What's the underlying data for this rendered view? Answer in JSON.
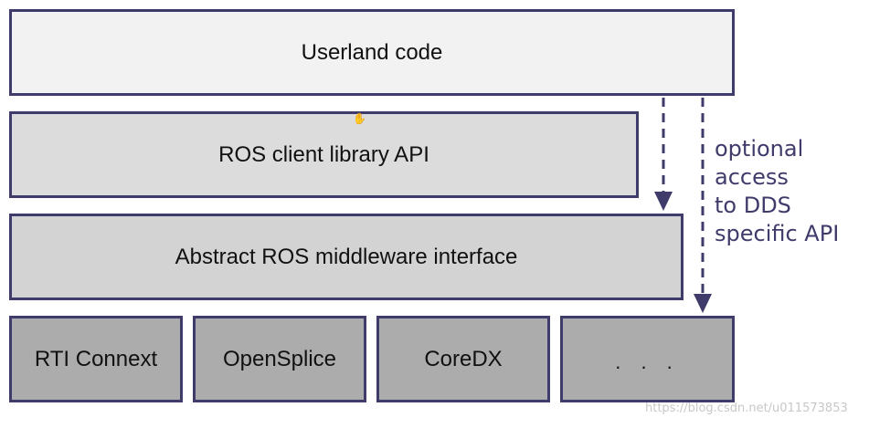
{
  "layers": {
    "userland": "Userland code",
    "client_api": "ROS client library API",
    "middleware": "Abstract ROS middleware interface",
    "implementations": [
      "RTI Connext",
      "OpenSplice",
      "CoreDX",
      ". . ."
    ]
  },
  "annotation": {
    "lines": [
      "optional",
      "access",
      "to DDS",
      "specific API"
    ]
  },
  "watermark": "https://blog.csdn.net/u011573853",
  "colors": {
    "border": "#3f3b6b",
    "userland_fill": "#f2f2f2",
    "client_fill": "#dcdcdc",
    "middleware_fill": "#d3d3d3",
    "implementation_fill": "#acacac",
    "annotation_text": "#3f3b6b"
  },
  "icons": {
    "cursor": "hand-cursor-icon"
  }
}
